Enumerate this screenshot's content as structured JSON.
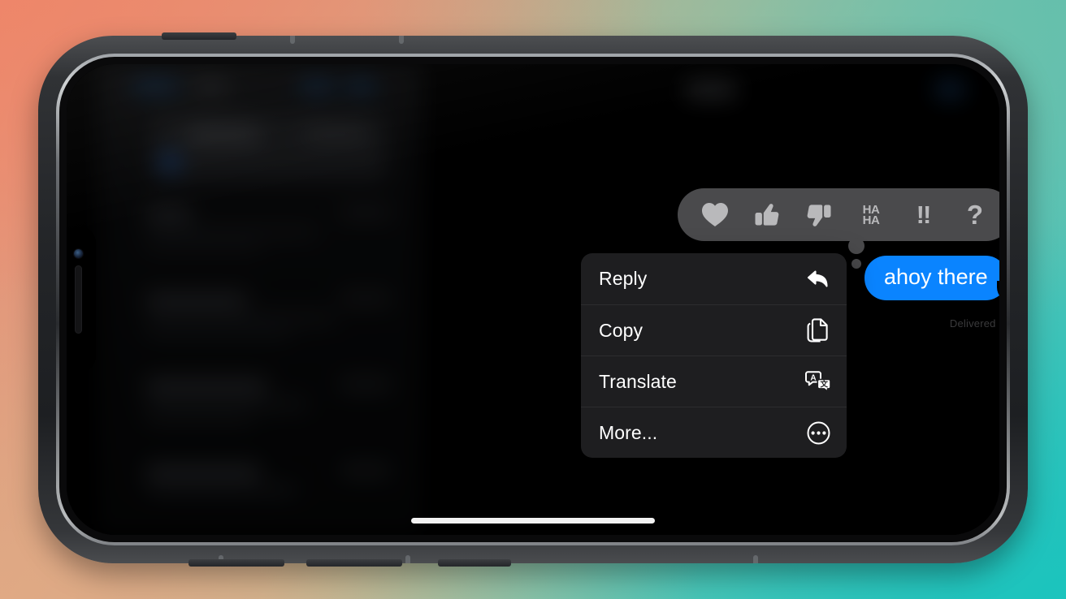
{
  "device": {
    "name": "iPhone",
    "orientation": "landscape"
  },
  "app": {
    "name": "Messages",
    "thread_title": "Jason"
  },
  "reaction_bar": {
    "name": "tapback-reaction-bar",
    "options": [
      {
        "id": "heart",
        "icon": "heart-icon",
        "label": "Love"
      },
      {
        "id": "thumbsup",
        "icon": "thumbs-up-icon",
        "label": "Like"
      },
      {
        "id": "thumbsdown",
        "icon": "thumbs-down-icon",
        "label": "Dislike"
      },
      {
        "id": "haha",
        "icon": "haha-icon",
        "label": "Haha",
        "line1": "HA",
        "line2": "HA"
      },
      {
        "id": "emphasize",
        "icon": "double-exclamation-icon",
        "label": "Emphasize",
        "glyph": "!!"
      },
      {
        "id": "question",
        "icon": "question-mark-icon",
        "label": "Question",
        "glyph": "?"
      }
    ]
  },
  "context_menu": {
    "name": "message-context-menu",
    "items": [
      {
        "label": "Reply",
        "icon": "reply-arrow-icon"
      },
      {
        "label": "Copy",
        "icon": "copy-documents-icon"
      },
      {
        "label": "Translate",
        "icon": "translate-bubbles-icon"
      },
      {
        "label": "More...",
        "icon": "ellipsis-circle-icon"
      }
    ]
  },
  "message": {
    "text": "ahoy there",
    "direction": "outgoing",
    "status": "Delivered",
    "bubble_color": "#0a84ff"
  },
  "translate_icon": {
    "left_glyph": "A",
    "right_glyph": "文"
  },
  "colors": {
    "imessage_blue": "#0a84ff",
    "menu_background": "#1e1e20",
    "reaction_bar_background": "#4a4a4c",
    "backdrop_start": "#ec8d72",
    "backdrop_end": "#27bdba"
  }
}
